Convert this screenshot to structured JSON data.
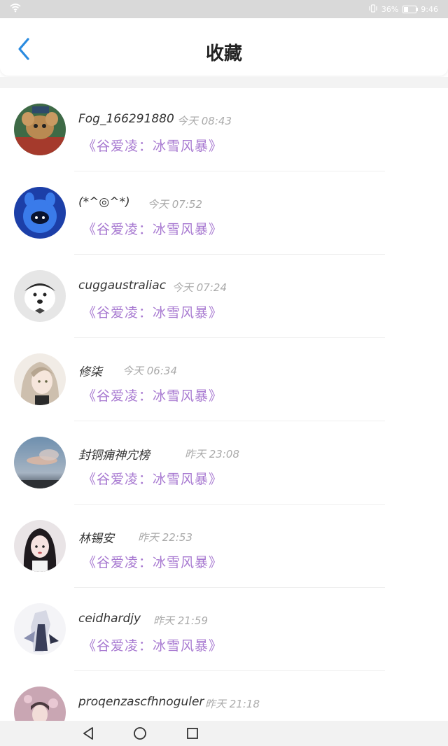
{
  "status_bar": {
    "battery": "36%",
    "time": "9:46",
    "battery_level": 0.36
  },
  "header": {
    "title": "收藏"
  },
  "favorite_title": "《谷爱凌：冰雪风暴》",
  "items": [
    {
      "username": "Fog_166291880",
      "time": "今天 08:43"
    },
    {
      "username": "(*^◎^*)",
      "time": "今天 07:52"
    },
    {
      "username": "cuggaustraliac",
      "time": "今天 07:24"
    },
    {
      "username": "修柒",
      "time": "今天 06:34"
    },
    {
      "username": "封铜痈神宂榜",
      "time": "昨天 23:08"
    },
    {
      "username": "林锡安",
      "time": "昨天 22:53"
    },
    {
      "username": "ceidhardjy",
      "time": "昨天 21:59"
    },
    {
      "username": "proqenzascfhnoguler",
      "time": "昨天 21:18"
    }
  ],
  "colors": {
    "accent": "#2a8be0",
    "fav_title": "#a87ad1"
  },
  "icons": [
    "wifi-icon",
    "vibrate-icon",
    "battery-icon",
    "back-icon",
    "nav-back-icon",
    "nav-home-icon",
    "nav-recent-icon"
  ]
}
